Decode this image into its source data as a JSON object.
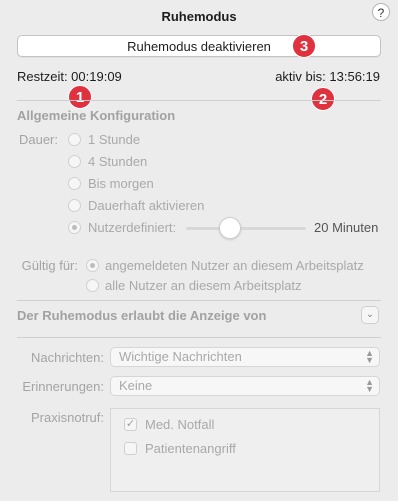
{
  "window": {
    "title": "Ruhemodus",
    "help_label": "?"
  },
  "deactivate_button": {
    "label": "Ruhemodus deaktivieren"
  },
  "status": {
    "remaining": "Restzeit: 00:19:09",
    "active_until": "aktiv bis: 13:56:19"
  },
  "badges": [
    "1",
    "2",
    "3"
  ],
  "config": {
    "heading": "Allgemeine Konfiguration",
    "duration_label": "Dauer:",
    "options": [
      "1 Stunde",
      "4 Stunden",
      "Bis morgen",
      "Dauerhaft aktivieren",
      "Nutzerdefiniert:"
    ],
    "selected_option": "Nutzerdefiniert:",
    "custom_value": "20 Minuten",
    "slider_fraction": 0.27
  },
  "validity": {
    "label": "Gültig für:",
    "options": [
      "angemeldeten Nutzer an diesem Arbeitsplatz",
      "alle Nutzer an diesem Arbeitsplatz"
    ],
    "selected_option": "angemeldeten Nutzer an diesem Arbeitsplatz"
  },
  "display": {
    "heading": "Der Ruhemodus erlaubt die Anzeige von",
    "messages_label": "Nachrichten:",
    "messages_value": "Wichtige Nachrichten",
    "reminders_label": "Erinnerungen:",
    "reminders_value": "Keine",
    "emergency_label": "Praxisnotruf:",
    "emergency_items": [
      {
        "label": "Med. Notfall",
        "checked": true
      },
      {
        "label": "Patientenangriff",
        "checked": false
      }
    ]
  },
  "colors": {
    "badge": "#e0313f",
    "background": "#ececec"
  }
}
